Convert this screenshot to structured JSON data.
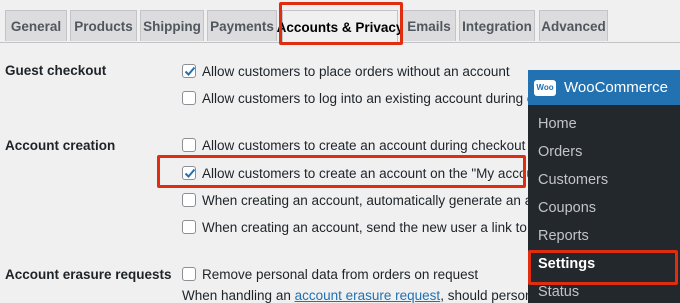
{
  "tabs": [
    {
      "label": "General"
    },
    {
      "label": "Products"
    },
    {
      "label": "Shipping"
    },
    {
      "label": "Payments"
    },
    {
      "label": "Accounts & Privacy"
    },
    {
      "label": "Emails"
    },
    {
      "label": "Integration"
    },
    {
      "label": "Advanced"
    }
  ],
  "sections": {
    "guest_checkout": {
      "label": "Guest checkout",
      "options": [
        {
          "label": "Allow customers to place orders without an account",
          "checked": true
        },
        {
          "label": "Allow customers to log into an existing account during checkout",
          "checked": false
        }
      ]
    },
    "account_creation": {
      "label": "Account creation",
      "options": [
        {
          "label": "Allow customers to create an account during checkout",
          "checked": false
        },
        {
          "label": "Allow customers to create an account on the \"My account\" page",
          "checked": true
        },
        {
          "label": "When creating an account, automatically generate an account use",
          "checked": false
        },
        {
          "label": "When creating an account, send the new user a link to set their pa",
          "checked": false
        }
      ]
    },
    "erasure": {
      "label": "Account erasure requests",
      "options": [
        {
          "label": "Remove personal data from orders on request",
          "checked": false
        }
      ],
      "desc_prefix": "When handling an ",
      "desc_link": "account erasure request",
      "desc_suffix": ", should personal data wit"
    }
  },
  "admin_menu": {
    "logo_text": "Woo",
    "title": "WooCommerce",
    "items": [
      {
        "label": "Home"
      },
      {
        "label": "Orders"
      },
      {
        "label": "Customers"
      },
      {
        "label": "Coupons"
      },
      {
        "label": "Reports"
      },
      {
        "label": "Settings",
        "current": true
      },
      {
        "label": "Status"
      }
    ]
  },
  "colors": {
    "highlight": "#e12d0f",
    "brand": "#2271b1",
    "menu_bg": "#23282d"
  }
}
